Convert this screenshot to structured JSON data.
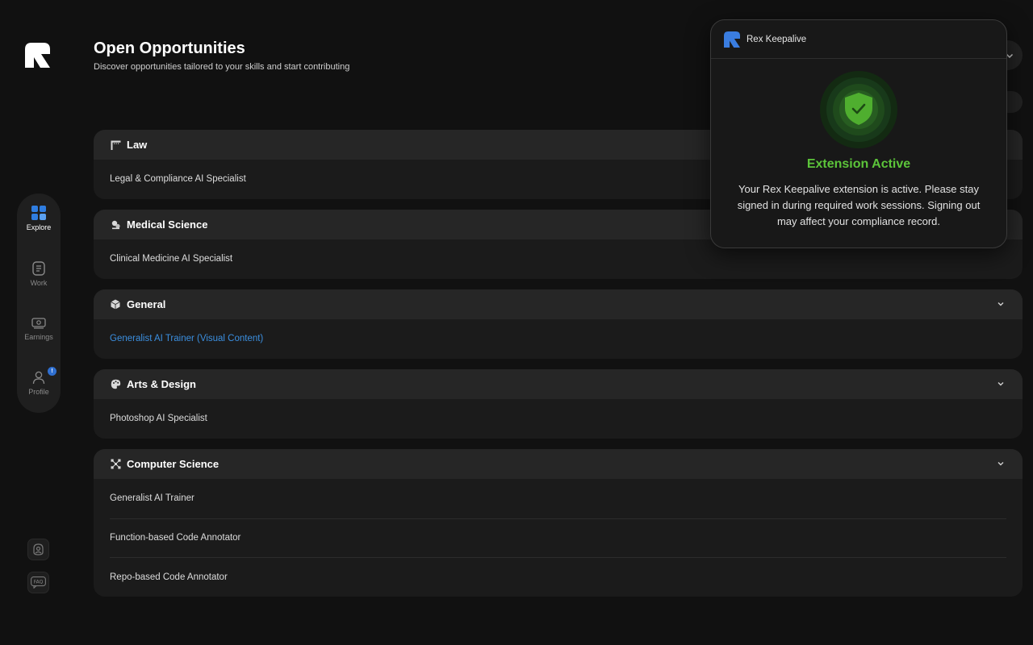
{
  "header": {
    "title": "Open Opportunities",
    "subtitle": "Discover opportunities tailored to your skills and start contributing"
  },
  "sidebar": {
    "items": [
      {
        "label": "Explore",
        "icon": "grid-icon",
        "active": true
      },
      {
        "label": "Work",
        "icon": "document-icon",
        "active": false
      },
      {
        "label": "Earnings",
        "icon": "cash-icon",
        "active": false
      },
      {
        "label": "Profile",
        "icon": "user-icon",
        "active": false,
        "badge": "!"
      }
    ],
    "bottom": [
      {
        "icon": "support-agent-icon"
      },
      {
        "icon": "faq-icon",
        "text": "FAQ"
      }
    ]
  },
  "categories": [
    {
      "name": "Law",
      "icon": "gavel-icon",
      "roles": [
        "Legal & Compliance AI Specialist"
      ]
    },
    {
      "name": "Medical Science",
      "icon": "microscope-icon",
      "roles": [
        "Clinical Medicine AI Specialist"
      ]
    },
    {
      "name": "General",
      "icon": "cube-icon",
      "roles": [
        "Generalist AI Trainer (Visual Content)"
      ]
    },
    {
      "name": "Arts & Design",
      "icon": "palette-icon",
      "roles": [
        "Photoshop AI Specialist"
      ]
    },
    {
      "name": "Computer Science",
      "icon": "network-icon",
      "roles": [
        "Generalist AI Trainer",
        "Function-based Code Annotator",
        "Repo-based Code Annotator"
      ]
    }
  ],
  "extension_popup": {
    "name": "Rex Keepalive",
    "status_title": "Extension Active",
    "message": "Your Rex Keepalive extension is active. Please stay signed in during required work sessions. Signing out may affect your compliance record.",
    "accent": "#5cc43a"
  },
  "colors": {
    "background": "#111111",
    "card": "#1b1b1b",
    "card_header": "#262626",
    "link": "#3b8fe0",
    "brand_blue": "#3a7de0"
  }
}
